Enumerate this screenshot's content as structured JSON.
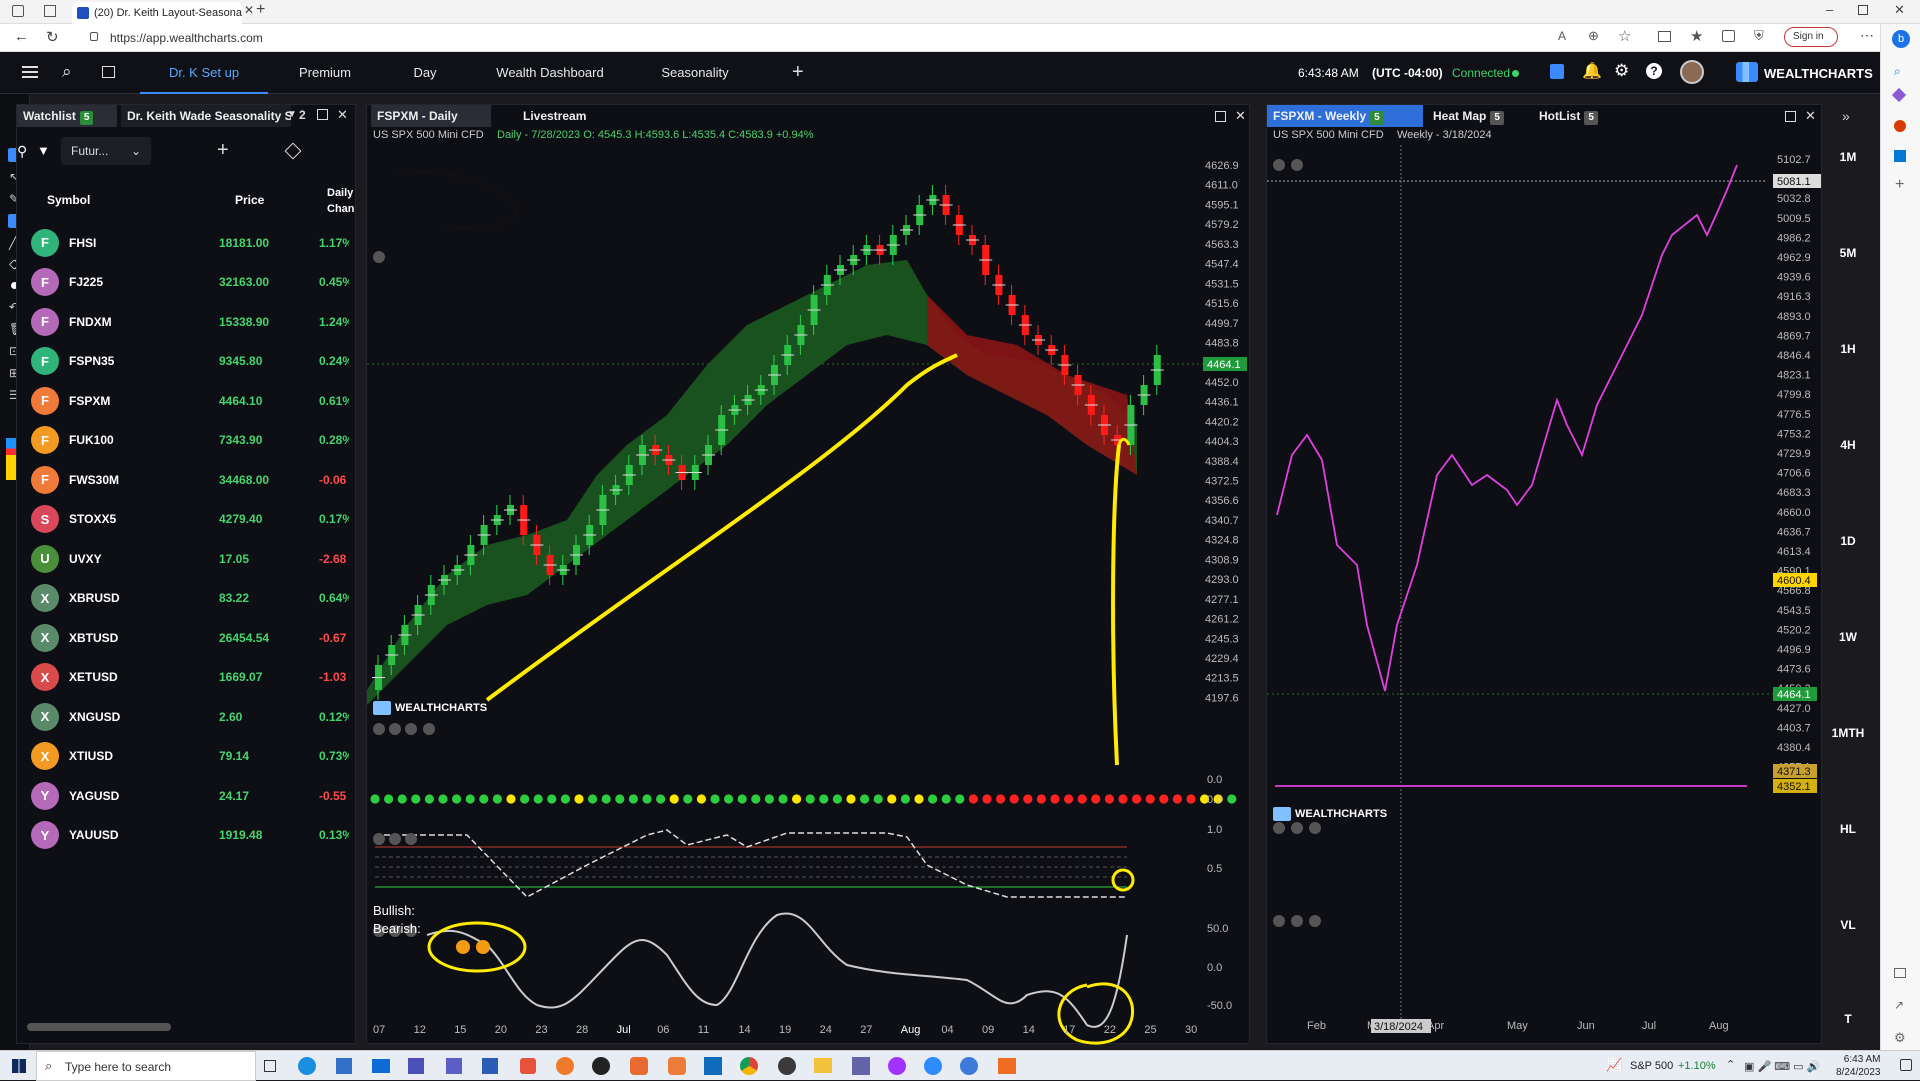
{
  "browser": {
    "tab_title": "(20) Dr. Keith Layout-Seasonal -",
    "url": "https://app.wealthcharts.com",
    "sign_in": "Sign in"
  },
  "nav": {
    "tabs": [
      "Dr. K Set up",
      "Premium",
      "Day",
      "Wealth Dashboard",
      "Seasonality"
    ],
    "active_tab": "Dr. K Set up",
    "time": "6:43:48 AM",
    "tz": "(UTC -04:00)",
    "status": "Connected",
    "brand": "WEALTHCHARTS"
  },
  "watchlist": {
    "tab_label": "Watchlist",
    "tab_count": "5",
    "second_tab": "Dr. Keith Wade Seasonality S",
    "second_count": "2",
    "filter": "Futur...",
    "col_symbol": "Symbol",
    "col_price": "Price",
    "col_change_1": "Daily",
    "col_change_2": "Chan",
    "rows": [
      {
        "letter": "F",
        "symbol": "FHSI",
        "price": "18181.00",
        "change": "1.17%",
        "color": "#2fb47c",
        "pos": true
      },
      {
        "letter": "F",
        "symbol": "FJ225",
        "price": "32163.00",
        "change": "0.45%",
        "color": "#b46ab8",
        "pos": true
      },
      {
        "letter": "F",
        "symbol": "FNDXM",
        "price": "15338.90",
        "change": "1.24%",
        "color": "#b46ab8",
        "pos": true
      },
      {
        "letter": "F",
        "symbol": "FSPN35",
        "price": "9345.80",
        "change": "0.24%",
        "color": "#2fb47c",
        "pos": true
      },
      {
        "letter": "F",
        "symbol": "FSPXM",
        "price": "4464.10",
        "change": "0.61%",
        "color": "#f07a3a",
        "pos": true
      },
      {
        "letter": "F",
        "symbol": "FUK100",
        "price": "7343.90",
        "change": "0.28%",
        "color": "#f29a22",
        "pos": true
      },
      {
        "letter": "F",
        "symbol": "FWS30M",
        "price": "34468.00",
        "change": "-0.06",
        "color": "#f07a3a",
        "pos": false
      },
      {
        "letter": "S",
        "symbol": "STOXX5",
        "price": "4279.40",
        "change": "0.17%",
        "color": "#d9475a",
        "pos": true
      },
      {
        "letter": "U",
        "symbol": "UVXY",
        "price": "17.05",
        "change": "-2.68",
        "color": "#4a8f3a",
        "pos": false
      },
      {
        "letter": "X",
        "symbol": "XBRUSD",
        "price": "83.22",
        "change": "0.64%",
        "color": "#5a8a6a",
        "pos": true
      },
      {
        "letter": "X",
        "symbol": "XBTUSD",
        "price": "26454.54",
        "change": "-0.67",
        "color": "#5a8a6a",
        "pos": false
      },
      {
        "letter": "X",
        "symbol": "XETUSD",
        "price": "1669.07",
        "change": "-1.03",
        "color": "#d94a4a",
        "pos": false
      },
      {
        "letter": "X",
        "symbol": "XNGUSD",
        "price": "2.60",
        "change": "0.12%",
        "color": "#5a8a6a",
        "pos": true
      },
      {
        "letter": "X",
        "symbol": "XTIUSD",
        "price": "79.14",
        "change": "0.73%",
        "color": "#f29a22",
        "pos": true
      },
      {
        "letter": "Y",
        "symbol": "YAGUSD",
        "price": "24.17",
        "change": "-0.55",
        "color": "#b46ab8",
        "pos": false
      },
      {
        "letter": "Y",
        "symbol": "YAUUSD",
        "price": "1919.48",
        "change": "0.13%",
        "color": "#b46ab8",
        "pos": true
      }
    ]
  },
  "daily_chart": {
    "tab_label": "FSPXM - Daily",
    "tab2": "Livestream",
    "symbol": "US SPX 500 Mini CFD",
    "ohlc": "Daily - 7/28/2023 O: 4545.3 H:4593.6 L:4535.4 C:4583.9 +0.94%",
    "last_price": "4464.1",
    "brand": "WEALTHCHARTS",
    "price_ticks": [
      "4626.9",
      "4611.0",
      "4595.1",
      "4579.2",
      "4563.3",
      "4547.4",
      "4531.5",
      "4515.6",
      "4499.7",
      "4483.8",
      "4467.9",
      "4452.0",
      "4436.1",
      "4420.2",
      "4404.3",
      "4388.4",
      "4372.5",
      "4356.6",
      "4340.7",
      "4324.8",
      "4308.9",
      "4293.0",
      "4277.1",
      "4261.2",
      "4245.3",
      "4229.4",
      "4213.5",
      "4197.6"
    ],
    "osc1_ticks": [
      "0.0",
      "0.0"
    ],
    "osc2_ticks": [
      "1.0",
      "0.5"
    ],
    "osc3_ticks": [
      "50.0",
      "0.0",
      "-50.0"
    ],
    "bullish_label": "Bullish:",
    "bearish_label": "Bearish:",
    "x_ticks": [
      "07",
      "12",
      "15",
      "20",
      "23",
      "28",
      "Jul",
      "06",
      "11",
      "14",
      "19",
      "24",
      "27",
      "Aug",
      "04",
      "09",
      "14",
      "17",
      "22",
      "25",
      "30"
    ],
    "dot_colors": [
      "g",
      "g",
      "g",
      "g",
      "g",
      "g",
      "g",
      "g",
      "g",
      "g",
      "y",
      "g",
      "g",
      "g",
      "g",
      "y",
      "g",
      "g",
      "g",
      "g",
      "g",
      "g",
      "y",
      "g",
      "y",
      "g",
      "g",
      "g",
      "g",
      "g",
      "g",
      "y",
      "g",
      "g",
      "g",
      "y",
      "g",
      "g",
      "y",
      "g",
      "y",
      "g",
      "g",
      "g",
      "r",
      "r",
      "r",
      "r",
      "r",
      "r",
      "r",
      "r",
      "r",
      "r",
      "r",
      "r",
      "r",
      "r",
      "r",
      "r",
      "r",
      "y",
      "y",
      "g"
    ]
  },
  "weekly_chart": {
    "tab_label": "FSPXM - Weekly",
    "tab_badge": "5",
    "tab2": "Heat Map",
    "tab2_badge": "5",
    "tab3": "HotList",
    "tab3_badge": "5",
    "symbol": "US SPX 500 Mini CFD",
    "subtitle": "Weekly - 3/18/2024",
    "cursor_price": "5081.1",
    "marker_price_1": "4600.4",
    "marker_price_2": "4464.1",
    "marker_price_3": "4371.3",
    "marker_price_4": "4352.1",
    "price_ticks": [
      "5102.7",
      "5056.1",
      "5032.8",
      "5009.5",
      "4986.2",
      "4962.9",
      "4939.6",
      "4916.3",
      "4893.0",
      "4869.7",
      "4846.4",
      "4823.1",
      "4799.8",
      "4776.5",
      "4753.2",
      "4729.9",
      "4706.6",
      "4683.3",
      "4660.0",
      "4636.7",
      "4613.4",
      "4590.1",
      "4566.8",
      "4543.5",
      "4520.2",
      "4496.9",
      "4473.6",
      "4450.3",
      "4427.0",
      "4403.7",
      "4380.4",
      "4357.1",
      "4333.8"
    ],
    "x_ticks": [
      "Feb",
      "Mar",
      "Apr",
      "May",
      "Jun",
      "Jul",
      "Aug"
    ],
    "cursor_date": "3/18/2024",
    "brand": "WEALTHCHARTS"
  },
  "timeframes": [
    "1M",
    "5M",
    "1H",
    "4H",
    "1D",
    "1W",
    "1MTH",
    "HL",
    "VL",
    "T"
  ],
  "taskbar": {
    "search": "Type here to search",
    "ticker": "S&P 500",
    "ticker_change": "+1.10%",
    "time": "6:43 AM",
    "date": "8/24/2023"
  }
}
